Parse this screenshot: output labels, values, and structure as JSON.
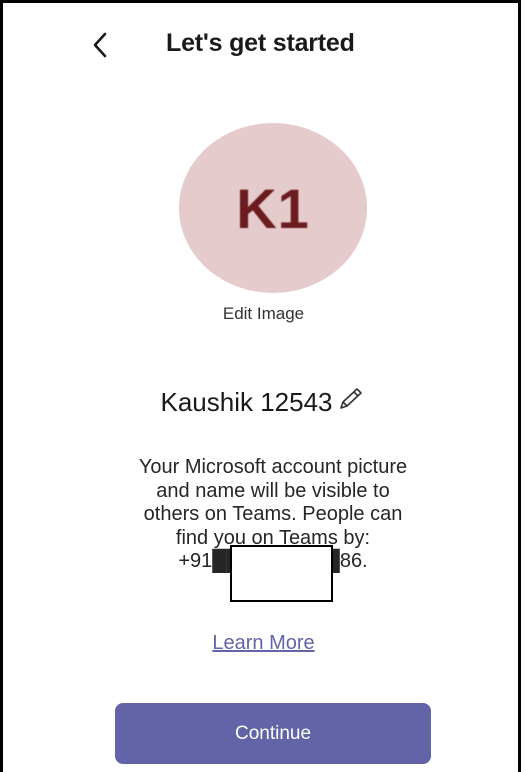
{
  "header": {
    "title": "Let's get started",
    "back_icon": "chevron-left-icon"
  },
  "profile": {
    "initials": "K1",
    "avatar_color": "#e6cbcd",
    "initials_color": "#6b1c1f",
    "edit_image_label": "Edit Image",
    "display_name": "Kaushik 12543",
    "edit_name_icon": "pencil-icon"
  },
  "description": {
    "lines": [
      "Your Microsoft account picture",
      "and name will be visible to",
      "others on Teams. People can",
      "find you on Teams by:",
      "+91█████████86."
    ],
    "phone_visible_prefix": "+91",
    "phone_visible_suffix": "86."
  },
  "links": {
    "learn_more": "Learn More"
  },
  "actions": {
    "continue_label": "Continue"
  },
  "colors": {
    "accent": "#6264a7"
  }
}
